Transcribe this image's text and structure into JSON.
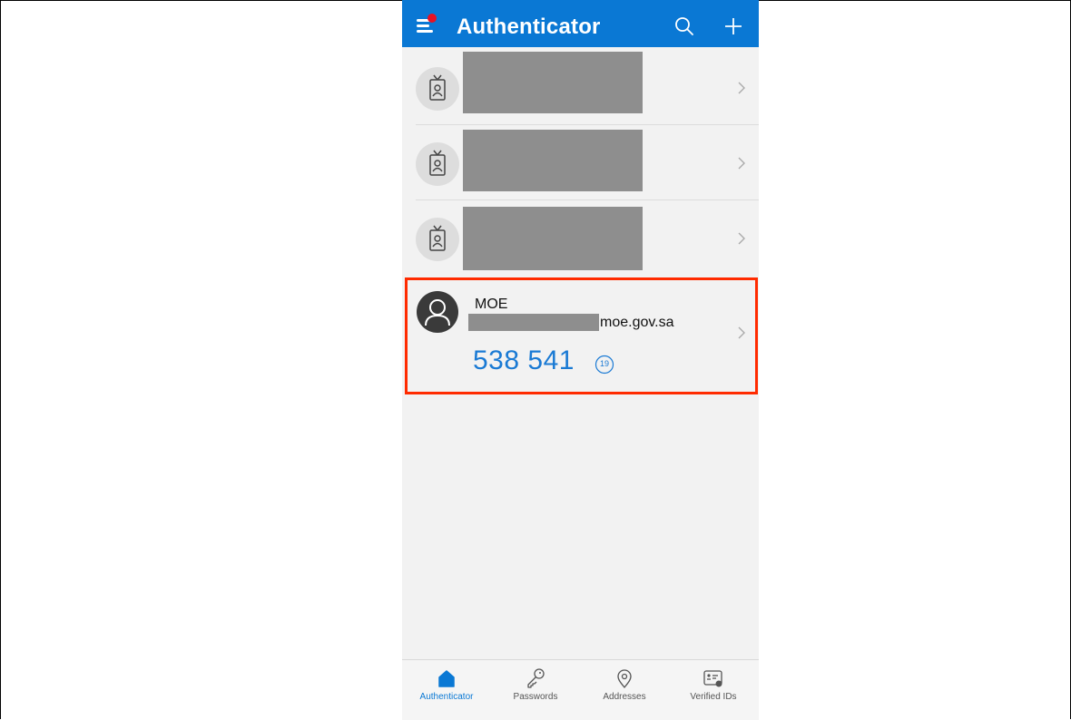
{
  "header": {
    "title": "Authenticator",
    "menu_icon": "hamburger-menu-icon",
    "notification_color": "#e81123",
    "search_icon": "search-icon",
    "add_icon": "plus-icon",
    "bar_color": "#0a78d4"
  },
  "accounts": [
    {
      "icon": "id-badge-icon",
      "redacted": true
    },
    {
      "icon": "id-badge-icon",
      "redacted": true
    },
    {
      "icon": "id-badge-icon",
      "redacted": true
    },
    {
      "icon": "person-avatar-icon",
      "name": "MOE",
      "email_suffix": "moe.gov.sa",
      "code": "538 541",
      "seconds_remaining": "19",
      "highlighted": true,
      "highlight_color": "#ff2b00"
    }
  ],
  "tabs": [
    {
      "label": "Authenticator",
      "icon": "home-icon",
      "active": true
    },
    {
      "label": "Passwords",
      "icon": "key-icon",
      "active": false
    },
    {
      "label": "Addresses",
      "icon": "location-pin-icon",
      "active": false
    },
    {
      "label": "Verified IDs",
      "icon": "verified-id-card-icon",
      "active": false
    }
  ]
}
